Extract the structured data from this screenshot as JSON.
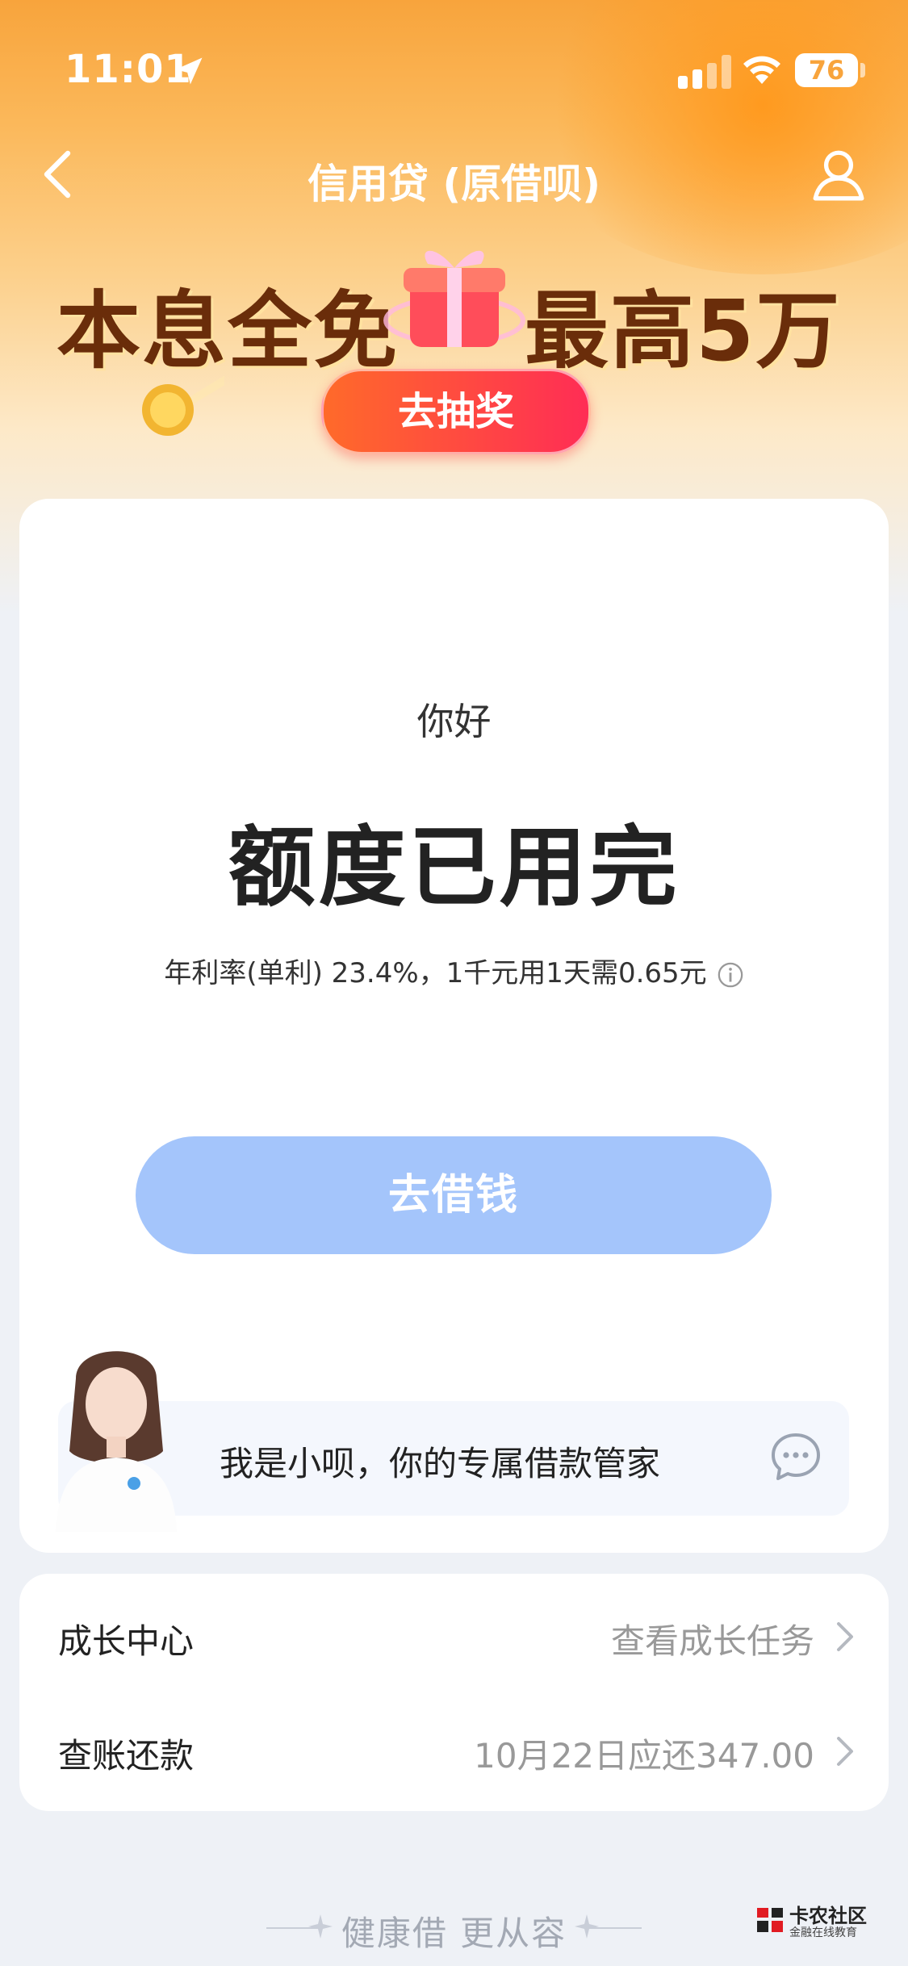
{
  "status_bar": {
    "time": "11:01",
    "battery": "76"
  },
  "nav": {
    "title": "信用贷 (原借呗)"
  },
  "banner": {
    "text_left": "本息全免",
    "text_right": "最高5万",
    "lottery_label": "去抽奖"
  },
  "main_card": {
    "greeting": "你好",
    "limit_status": "额度已用完",
    "rate_text": "年利率(单利) 23.4%，1千元用1天需0.65元",
    "borrow_label": "去借钱",
    "assistant_text": "我是小呗，你的专属借款管家"
  },
  "list": [
    {
      "label": "成长中心",
      "value": "查看成长任务"
    },
    {
      "label": "查账还款",
      "value": "10月22日应还347.00"
    }
  ],
  "footer": {
    "slogan": "健康借 更从容"
  },
  "watermark": {
    "title": "卡农社区",
    "subtitle": "金融在线教育"
  },
  "colors": {
    "accent_orange": "#f8a43c",
    "borrow_button": "#a4c5fb",
    "lottery_button": "#ff2d55"
  }
}
